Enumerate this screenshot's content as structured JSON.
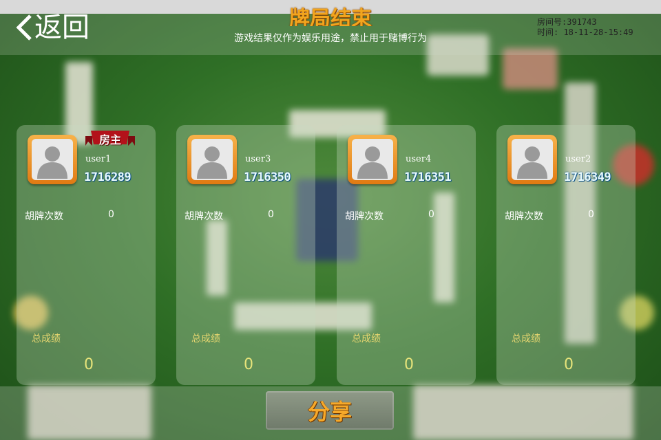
{
  "header": {
    "back_label": "返回",
    "title": "牌局结束",
    "subtitle": "游戏结果仅作为娱乐用途，禁止用于赌博行为",
    "room_line": "房间号:391743",
    "time_line": "时间: 18-11-28-15:49"
  },
  "players": [
    {
      "host_badge": "房主",
      "name": "user1",
      "id": "1716289",
      "win_label": "胡牌次数",
      "win_count": "0",
      "total_label": "总成绩",
      "total_score": "0"
    },
    {
      "name": "user3",
      "id": "1716350",
      "win_label": "胡牌次数",
      "win_count": "0",
      "total_label": "总成绩",
      "total_score": "0"
    },
    {
      "name": "user4",
      "id": "1716351",
      "win_label": "胡牌次数",
      "win_count": "0",
      "total_label": "总成绩",
      "total_score": "0"
    },
    {
      "name": "user2",
      "id": "1716349",
      "win_label": "胡牌次数",
      "win_count": "0",
      "total_label": "总成绩",
      "total_score": "0"
    }
  ],
  "footer": {
    "share_label": "分享"
  },
  "colors": {
    "table_green": "#2f6f26",
    "accent_orange": "#f2a51e",
    "id_blue": "#0a4e86",
    "badge_red": "#b3121a"
  }
}
